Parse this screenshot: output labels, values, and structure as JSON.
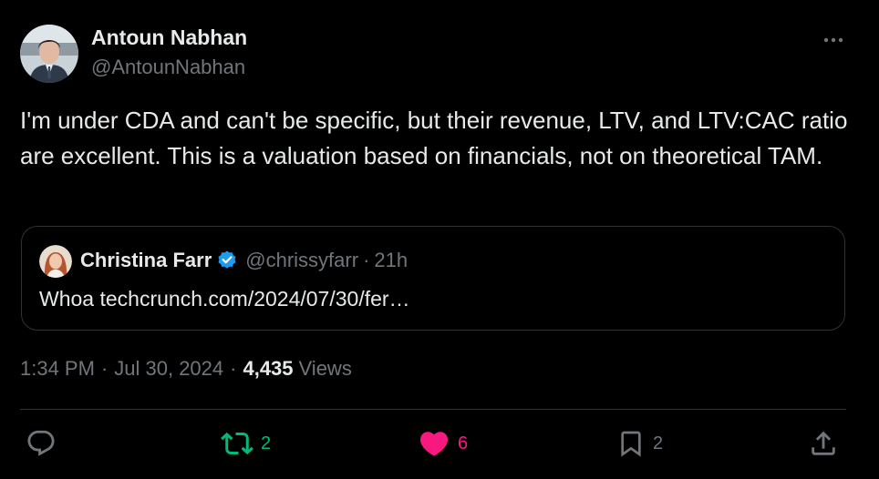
{
  "tweet": {
    "author": {
      "name": "Antoun Nabhan",
      "handle": "@AntounNabhan"
    },
    "text": "I'm under CDA and can't be specific, but their revenue, LTV, and LTV:CAC ratio are excellent. This is a valuation based on financials, not on theoretical TAM.",
    "more_icon": "more-dots-icon",
    "quote": {
      "name": "Christina Farr",
      "verified": true,
      "handle": "@chrissyfarr",
      "separator": "·",
      "time": "21h",
      "text": "Whoa techcrunch.com/2024/07/30/fer…"
    },
    "meta": {
      "time": "1:34 PM",
      "date": "Jul 30, 2024",
      "separator": "·",
      "views_count": "4,435",
      "views_label": "Views"
    },
    "actions": {
      "reply": {
        "icon": "reply-icon",
        "count": ""
      },
      "repost": {
        "icon": "repost-icon",
        "count": "2"
      },
      "like": {
        "icon": "heart-icon",
        "count": "6",
        "liked": true
      },
      "bookmark": {
        "icon": "bookmark-icon",
        "count": "2"
      },
      "share": {
        "icon": "share-icon",
        "count": ""
      }
    }
  },
  "colors": {
    "background": "#000000",
    "primary_text": "#e7e9ea",
    "secondary_text": "#71767b",
    "border": "#2f3336",
    "repost_green": "#00ba7c",
    "like_pink": "#f91880",
    "verified_blue": "#1d9bf0"
  }
}
